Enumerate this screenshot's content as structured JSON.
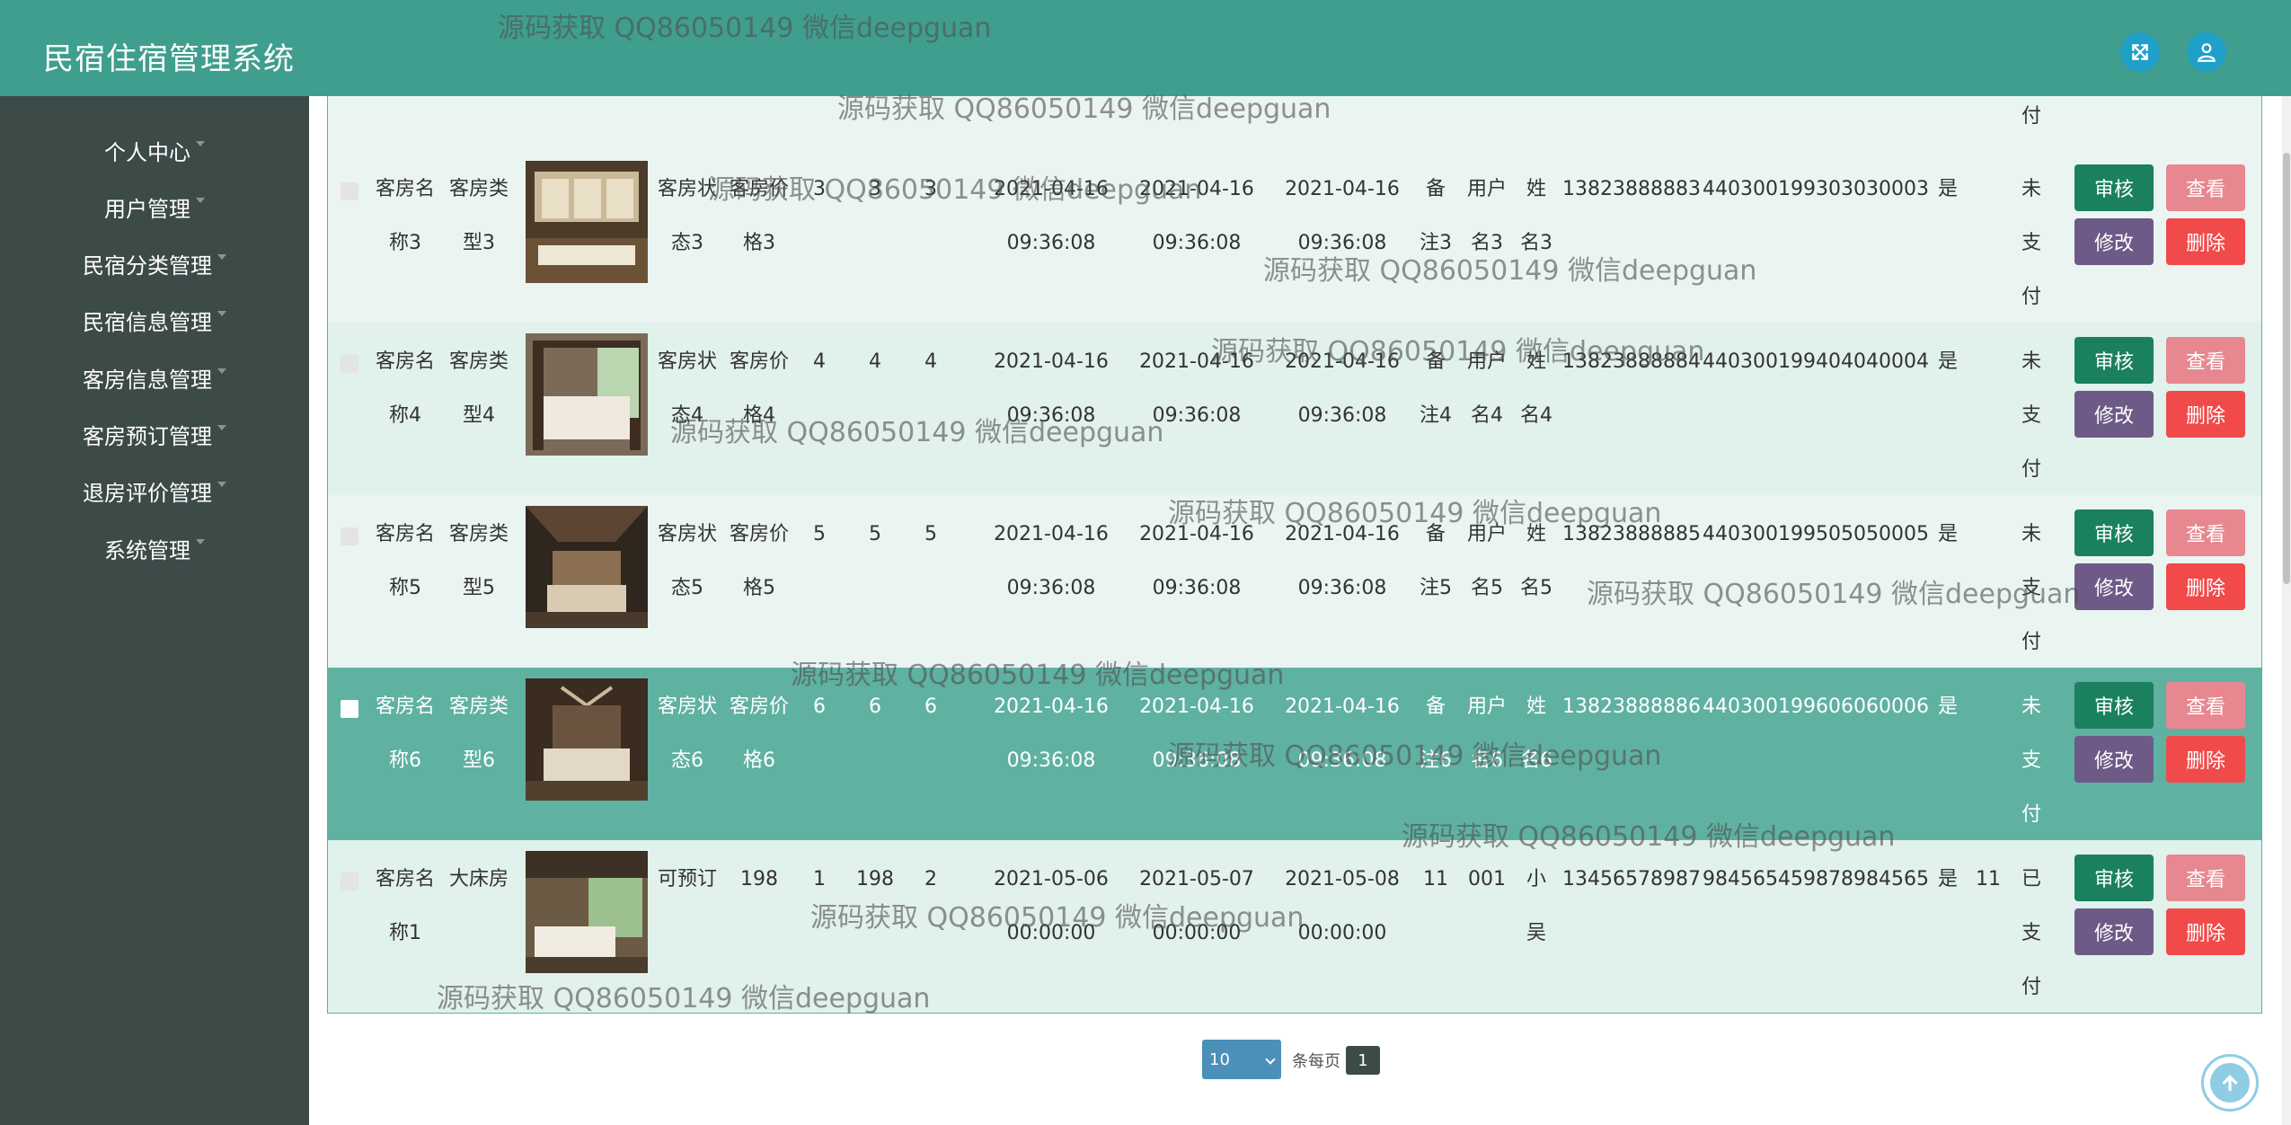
{
  "app": {
    "title": "民宿住宿管理系统"
  },
  "header": {
    "fullscreen_icon": "expand-icon",
    "user_icon": "user-icon"
  },
  "sidebar": {
    "items": [
      {
        "label": "个人中心"
      },
      {
        "label": "用户管理"
      },
      {
        "label": "民宿分类管理"
      },
      {
        "label": "民宿信息管理"
      },
      {
        "label": "客房信息管理"
      },
      {
        "label": "客房预订管理"
      },
      {
        "label": "退房评价管理"
      },
      {
        "label": "系统管理"
      }
    ]
  },
  "top_row": {
    "pay_char": "付"
  },
  "rows": [
    {
      "name_a": "客房名",
      "name_b": "称3",
      "type_a": "客房类",
      "type_b": "型3",
      "status_a": "客房状",
      "status_b": "态3",
      "price_a": "客房价",
      "price_b": "格3",
      "n1": "3",
      "n2": "3",
      "n3": "3",
      "date1_a": "2021-04-16",
      "date1_b": "09:36:08",
      "date2_a": "2021-04-16",
      "date2_b": "09:36:08",
      "date3_a": "2021-04-16",
      "date3_b": "09:36:08",
      "note_a": "备",
      "note_b": "注3",
      "user_a": "用户",
      "user_b": "名3",
      "surname_a": "姓",
      "surname_b": "名3",
      "phone": "13823888883",
      "idcard": "440300199303030003",
      "yes": "是",
      "extra": "",
      "pay_1": "未",
      "pay_2": "支",
      "pay_3": "付"
    },
    {
      "name_a": "客房名",
      "name_b": "称4",
      "type_a": "客房类",
      "type_b": "型4",
      "status_a": "客房状",
      "status_b": "态4",
      "price_a": "客房价",
      "price_b": "格4",
      "n1": "4",
      "n2": "4",
      "n3": "4",
      "date1_a": "2021-04-16",
      "date1_b": "09:36:08",
      "date2_a": "2021-04-16",
      "date2_b": "09:36:08",
      "date3_a": "2021-04-16",
      "date3_b": "09:36:08",
      "note_a": "备",
      "note_b": "注4",
      "user_a": "用户",
      "user_b": "名4",
      "surname_a": "姓",
      "surname_b": "名4",
      "phone": "13823888884",
      "idcard": "440300199404040004",
      "yes": "是",
      "extra": "",
      "pay_1": "未",
      "pay_2": "支",
      "pay_3": "付"
    },
    {
      "name_a": "客房名",
      "name_b": "称5",
      "type_a": "客房类",
      "type_b": "型5",
      "status_a": "客房状",
      "status_b": "态5",
      "price_a": "客房价",
      "price_b": "格5",
      "n1": "5",
      "n2": "5",
      "n3": "5",
      "date1_a": "2021-04-16",
      "date1_b": "09:36:08",
      "date2_a": "2021-04-16",
      "date2_b": "09:36:08",
      "date3_a": "2021-04-16",
      "date3_b": "09:36:08",
      "note_a": "备",
      "note_b": "注5",
      "user_a": "用户",
      "user_b": "名5",
      "surname_a": "姓",
      "surname_b": "名5",
      "phone": "13823888885",
      "idcard": "440300199505050005",
      "yes": "是",
      "extra": "",
      "pay_1": "未",
      "pay_2": "支",
      "pay_3": "付"
    },
    {
      "name_a": "客房名",
      "name_b": "称6",
      "type_a": "客房类",
      "type_b": "型6",
      "status_a": "客房状",
      "status_b": "态6",
      "price_a": "客房价",
      "price_b": "格6",
      "n1": "6",
      "n2": "6",
      "n3": "6",
      "date1_a": "2021-04-16",
      "date1_b": "09:36:08",
      "date2_a": "2021-04-16",
      "date2_b": "09:36:08",
      "date3_a": "2021-04-16",
      "date3_b": "09:36:08",
      "note_a": "备",
      "note_b": "注6",
      "user_a": "用户",
      "user_b": "名6",
      "surname_a": "姓",
      "surname_b": "名6",
      "phone": "13823888886",
      "idcard": "440300199606060006",
      "yes": "是",
      "extra": "",
      "pay_1": "未",
      "pay_2": "支",
      "pay_3": "付"
    },
    {
      "name_a": "客房名",
      "name_b": "称1",
      "type_a": "大床房",
      "type_b": "",
      "status_a": "可预订",
      "status_b": "",
      "price_a": "198",
      "price_b": "",
      "n1": "1",
      "n2": "198",
      "n3": "2",
      "date1_a": "2021-05-06",
      "date1_b": "00:00:00",
      "date2_a": "2021-05-07",
      "date2_b": "00:00:00",
      "date3_a": "2021-05-08",
      "date3_b": "00:00:00",
      "note_a": "11",
      "note_b": "",
      "user_a": "001",
      "user_b": "",
      "surname_a": "小",
      "surname_b": "吴",
      "phone": "13456578987",
      "idcard": "984565459878984565",
      "yes": "是",
      "extra": "11",
      "pay_1": "已",
      "pay_2": "支",
      "pay_3": "付"
    }
  ],
  "actions": {
    "audit": "审核",
    "view": "查看",
    "edit": "修改",
    "delete": "删除"
  },
  "pagination": {
    "page_size": "10",
    "per_page_label": "条每页",
    "current_page": "1"
  },
  "watermark": "源码获取 QQ86050149 微信deepguan",
  "icons": {
    "back_to_top": "arrow-up-icon"
  }
}
